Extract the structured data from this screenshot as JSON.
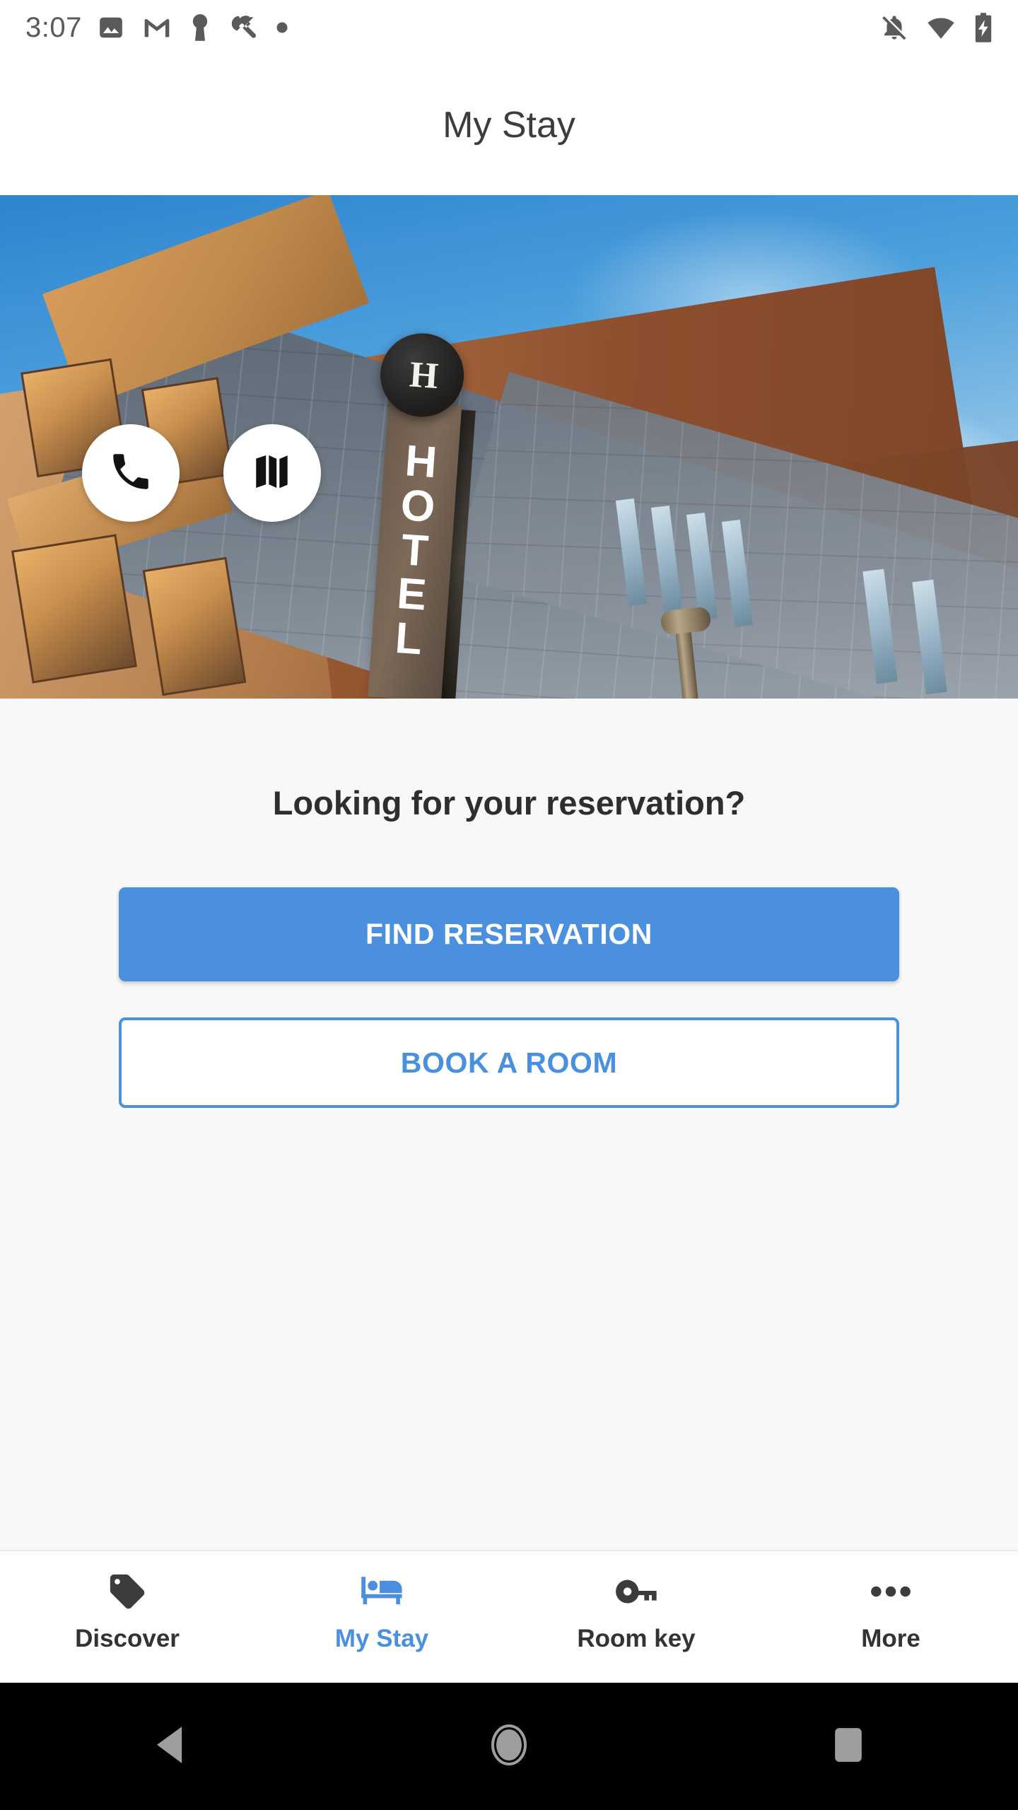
{
  "status_bar": {
    "clock": "3:07",
    "left_icons": [
      "image-icon",
      "gmail-icon",
      "keyhole-icon",
      "wrench-icon",
      "dot-icon"
    ],
    "right_icons": [
      "notifications-off-icon",
      "wifi-icon",
      "battery-charging-icon"
    ]
  },
  "app_bar": {
    "title": "My Stay"
  },
  "hero": {
    "alt": "hotel-building-exterior",
    "sign_text": "HOTEL",
    "sign_letters": [
      "H",
      "O",
      "T",
      "E",
      "L"
    ],
    "badge_text": "H",
    "actions": [
      {
        "name": "call-button",
        "icon": "phone-icon"
      },
      {
        "name": "map-button",
        "icon": "map-icon"
      }
    ]
  },
  "main": {
    "prompt": "Looking for your reservation?",
    "find_reservation_label": "FIND RESERVATION",
    "book_a_room_label": "BOOK A ROOM"
  },
  "bottom_nav": {
    "items": [
      {
        "label": "Discover",
        "icon": "tag-icon",
        "active": false
      },
      {
        "label": "My Stay",
        "icon": "bed-icon",
        "active": true
      },
      {
        "label": "Room key",
        "icon": "key-icon",
        "active": false
      },
      {
        "label": "More",
        "icon": "more-horizontal-icon",
        "active": false
      }
    ]
  },
  "android_nav": {
    "back": "back-triangle-icon",
    "home": "home-circle-icon",
    "recents": "recents-square-icon"
  },
  "colors": {
    "accent": "#4A90DE",
    "content_background": "#F8F8F8",
    "surface": "#FFFFFF",
    "text_primary": "#2E2E2E",
    "status_icon": "#5A5A5A",
    "nav_inactive": "#333333",
    "system_nav_background": "#000000"
  }
}
